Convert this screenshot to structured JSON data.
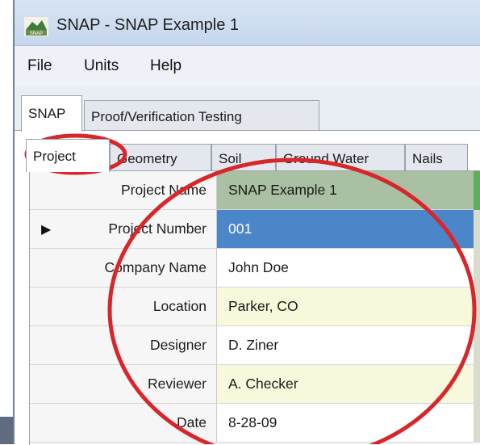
{
  "window": {
    "title": "SNAP - SNAP Example 1",
    "icon": "snap-app-icon"
  },
  "menu": [
    {
      "label": "File"
    },
    {
      "label": "Units"
    },
    {
      "label": "Help"
    }
  ],
  "outer_tabs": [
    {
      "label": "SNAP",
      "active": true
    },
    {
      "label": "Proof/Verification Testing",
      "active": false
    }
  ],
  "inner_tabs": [
    {
      "label": "Project",
      "active": true
    },
    {
      "label": "Geometry",
      "active": false
    },
    {
      "label": "Soil",
      "active": false
    },
    {
      "label": "Ground Water",
      "active": false
    },
    {
      "label": "Nails",
      "active": false
    }
  ],
  "project_grid": [
    {
      "label": "Project Name",
      "value": "SNAP Example 1",
      "current": false,
      "bg": "#a9c0a3"
    },
    {
      "label": "Project Number",
      "value": "001",
      "current": true,
      "bg": "#4a86c8"
    },
    {
      "label": "Company Name",
      "value": "John Doe",
      "current": false,
      "bg": "#ffffff"
    },
    {
      "label": "Location",
      "value": "Parker, CO",
      "current": false,
      "bg": "#f8f8dc"
    },
    {
      "label": "Designer",
      "value": "D. Ziner",
      "current": false,
      "bg": "#ffffff"
    },
    {
      "label": "Reviewer",
      "value": "A. Checker",
      "current": false,
      "bg": "#f8f8dc"
    },
    {
      "label": "Date",
      "value": "8-28-09",
      "current": false,
      "bg": "#ffffff"
    }
  ],
  "colors": {
    "annotation": "#d8262b",
    "selection": "#4a86c8",
    "header_row": "#a9c0a3",
    "alt_row": "#f8f8dc"
  }
}
